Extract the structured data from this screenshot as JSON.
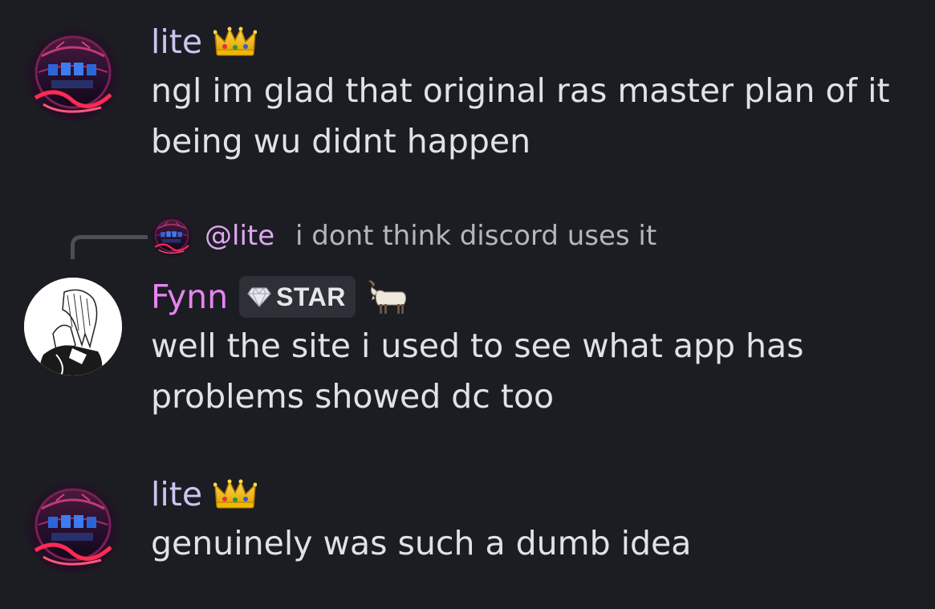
{
  "messages": [
    {
      "author": "lite",
      "author_icon": "crown-icon",
      "lines": [
        "ngl im glad that original ras master plan of it",
        "being wu didnt happen"
      ]
    },
    {
      "reply": {
        "mention": "@lite",
        "text": "i dont think discord uses it"
      },
      "author": "Fynn",
      "badge_label": "STAR",
      "badge_icon": "diamond-icon",
      "author_icon": "goat-icon",
      "lines": [
        "well the site i used to see what app has",
        "problems showed dc too"
      ]
    },
    {
      "author": "lite",
      "author_icon": "crown-icon",
      "lines": [
        "genuinely was such a dumb idea"
      ]
    }
  ],
  "colors": {
    "background": "#1c1d22",
    "lite_name": "#c9c6f2",
    "fynn_name": "#e485f0",
    "message_text": "#e1e2e6",
    "reply_text": "#b4b6bc"
  }
}
